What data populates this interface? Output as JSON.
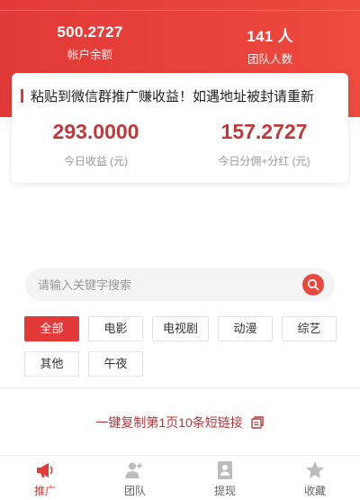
{
  "header": {
    "balance_value": "500.2727",
    "balance_label": "帐户余额",
    "team_value": "141 人",
    "team_label": "团队人数"
  },
  "notice": {
    "text": "粘贴到微信群推广赚收益！如遇地址被封请重新"
  },
  "earnings": {
    "today_value": "293.0000",
    "today_label": "今日收益 (元)",
    "share_value": "157.2727",
    "share_label": "今日分佣+分红 (元)"
  },
  "search": {
    "placeholder": "请输入关键字搜索"
  },
  "categories": [
    "全部",
    "电影",
    "电视剧",
    "动漫",
    "综艺",
    "其他",
    "午夜"
  ],
  "copy_link": {
    "label": "一键复制第1页10条短链接"
  },
  "tabs": [
    {
      "label": "推广",
      "icon": "megaphone-icon"
    },
    {
      "label": "团队",
      "icon": "team-icon"
    },
    {
      "label": "提现",
      "icon": "withdraw-icon"
    },
    {
      "label": "收藏",
      "icon": "star-icon"
    }
  ],
  "colors": {
    "brand": "#e23a38",
    "value_red": "#c0393a"
  }
}
